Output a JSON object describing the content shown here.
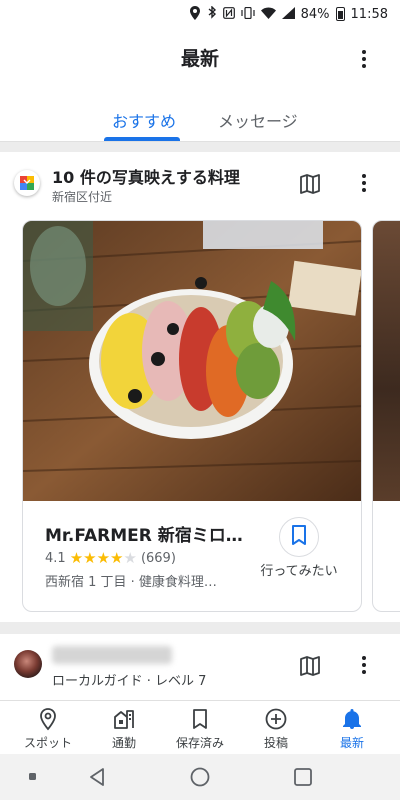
{
  "status_bar": {
    "battery": "84%",
    "time": "11:58"
  },
  "header": {
    "title": "最新"
  },
  "tabs": [
    {
      "label": "おすすめ",
      "active": true
    },
    {
      "label": "メッセージ",
      "active": false
    }
  ],
  "section": {
    "title": "10 件の写真映えする料理",
    "subtitle": "新宿区付近",
    "card": {
      "name": "Mr.FARMER 新宿ミロ…",
      "rating": "4.1",
      "rating_value": 4.1,
      "reviews": "(669)",
      "address": "西新宿 1 丁目 · 健康食料理…",
      "want_label": "行ってみたい"
    }
  },
  "section2": {
    "subtitle": "ローカルガイド · レベル 7"
  },
  "bottom_nav": [
    {
      "label": "スポット",
      "icon": "place-icon",
      "active": false
    },
    {
      "label": "通勤",
      "icon": "commute-icon",
      "active": false
    },
    {
      "label": "保存済み",
      "icon": "bookmark-icon",
      "active": false
    },
    {
      "label": "投稿",
      "icon": "add-circle-icon",
      "active": false
    },
    {
      "label": "最新",
      "icon": "bell-icon",
      "active": true
    }
  ],
  "colors": {
    "accent": "#1a73e8",
    "star": "#fbbc04"
  }
}
